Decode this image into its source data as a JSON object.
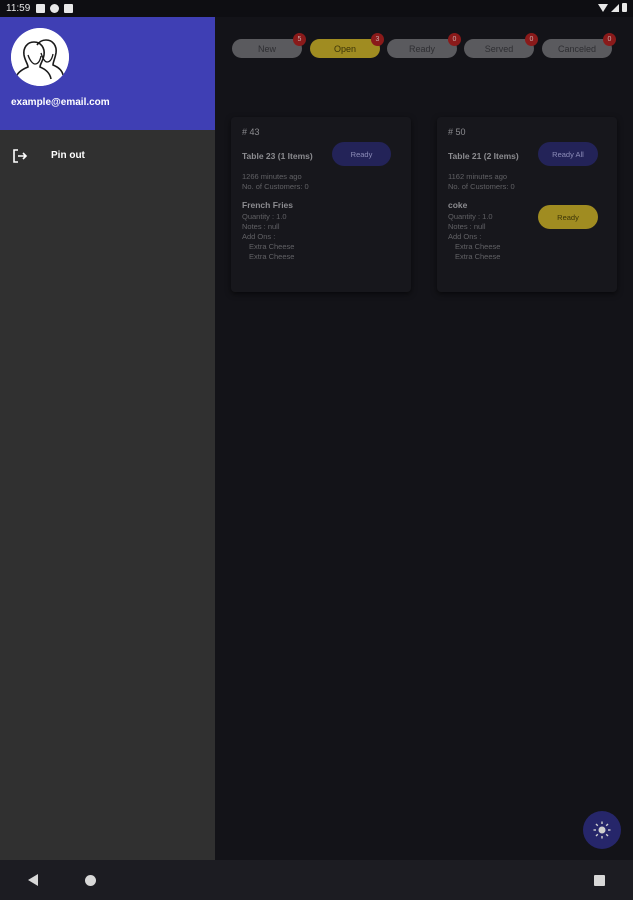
{
  "status_bar": {
    "time": "11:59"
  },
  "tabs": [
    {
      "label": "New",
      "badge": "5",
      "active": false
    },
    {
      "label": "Open",
      "badge": "3",
      "active": true
    },
    {
      "label": "Ready",
      "badge": "0",
      "active": false
    },
    {
      "label": "Served",
      "badge": "0",
      "active": false
    },
    {
      "label": "Canceled",
      "badge": "0",
      "active": false
    }
  ],
  "orders": [
    {
      "number": "# 43",
      "table": "Table 23 (1 Items)",
      "primary_action": "Ready",
      "time_ago": "1266 minutes ago",
      "customers": "No. of Customers: 0",
      "item": {
        "name": "French Fries",
        "quantity": "Quantity : 1.0",
        "notes": "Notes : null",
        "addons_label": "Add Ons :",
        "addons": [
          "Extra Cheese",
          "Extra Cheese"
        ]
      }
    },
    {
      "number": "# 50",
      "table": "Table 21 (2 Items)",
      "primary_action": "Ready All",
      "item_action": "Ready",
      "time_ago": "1162 minutes ago",
      "customers": "No. of Customers: 0",
      "item": {
        "name": "coke",
        "quantity": "Quantity : 1.0",
        "notes": "Notes : null",
        "addons_label": "Add Ons :",
        "addons": [
          "Extra Cheese",
          "Extra Cheese"
        ]
      }
    }
  ],
  "drawer": {
    "email": "example@email.com",
    "menu": [
      {
        "label": "Pin out",
        "icon": "logout-icon"
      }
    ]
  },
  "fab": {
    "icon": "theme-toggle-sun-icon"
  },
  "colors": {
    "drawer_header": "#3f3fb4",
    "drawer_bg": "#303030",
    "accent_gold": "#a08c21",
    "accent_blue": "#232358",
    "badge_red": "#8a1a1a"
  }
}
